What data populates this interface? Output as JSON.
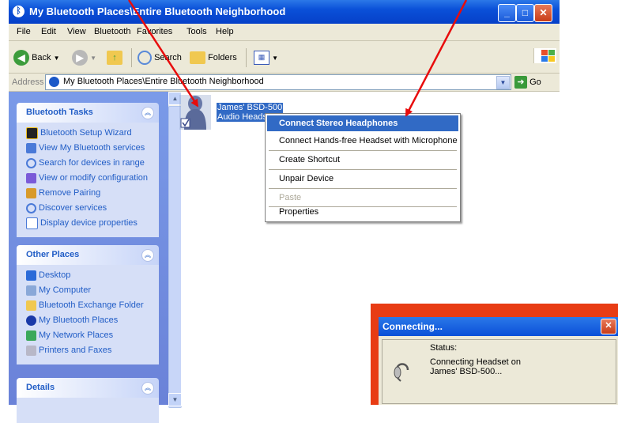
{
  "window": {
    "title": "My Bluetooth Places\\Entire Bluetooth Neighborhood",
    "controls": {
      "minimize": "_",
      "maximize": "□",
      "close": "✕"
    }
  },
  "menubar": {
    "items": [
      "File",
      "Edit",
      "View",
      "Bluetooth",
      "Favorites",
      "Tools",
      "Help"
    ]
  },
  "toolbar": {
    "back_label": "Back",
    "search_label": "Search",
    "folders_label": "Folders"
  },
  "address": {
    "label": "Address",
    "value": "My Bluetooth Places\\Entire Bluetooth Neighborhood",
    "go_label": "Go"
  },
  "sidebar": {
    "bluetooth_tasks": {
      "title": "Bluetooth Tasks",
      "items": [
        {
          "label": "Bluetooth Setup Wizard",
          "icon": "bluetooth-wizard-icon"
        },
        {
          "label": "View My Bluetooth services",
          "icon": "services-icon"
        },
        {
          "label": "Search for devices in range",
          "icon": "search-icon"
        },
        {
          "label": "View or modify configuration",
          "icon": "config-icon"
        },
        {
          "label": "Remove Pairing",
          "icon": "remove-pairing-icon"
        },
        {
          "label": "Discover services",
          "icon": "discover-icon"
        },
        {
          "label": "Display device properties",
          "icon": "properties-icon"
        }
      ]
    },
    "other_places": {
      "title": "Other Places",
      "items": [
        {
          "label": "Desktop",
          "icon": "desktop-icon"
        },
        {
          "label": "My Computer",
          "icon": "computer-icon"
        },
        {
          "label": "Bluetooth Exchange Folder",
          "icon": "folder-icon"
        },
        {
          "label": "My Bluetooth Places",
          "icon": "bluetooth-icon"
        },
        {
          "label": "My Network Places",
          "icon": "network-icon"
        },
        {
          "label": "Printers and Faxes",
          "icon": "printer-icon"
        }
      ]
    },
    "details": {
      "title": "Details"
    }
  },
  "device": {
    "name": "James' BSD-500",
    "type": "Audio Headse"
  },
  "context_menu": {
    "items": [
      {
        "label": "Connect Stereo Headphones",
        "state": "highlighted"
      },
      {
        "label": "Connect Hands-free Headset with Microphone",
        "state": "normal"
      },
      {
        "label": "Create Shortcut",
        "state": "normal"
      },
      {
        "label": "Unpair Device",
        "state": "normal"
      },
      {
        "label": "Paste",
        "state": "disabled"
      },
      {
        "label": "Properties",
        "state": "normal"
      }
    ]
  },
  "dialog": {
    "title": "Connecting...",
    "status_label": "Status:",
    "status_text": "Connecting Headset on James' BSD-500..."
  },
  "colors": {
    "xp_blue": "#0a50d8",
    "task_pane": "#6a82d8",
    "highlight": "#316ac5",
    "annotation_red": "#e83c14"
  }
}
